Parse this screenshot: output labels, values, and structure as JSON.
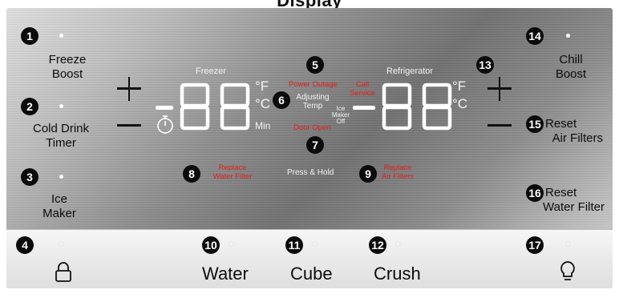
{
  "header": {
    "title_fragment": "Display"
  },
  "left_buttons": [
    {
      "num": "1",
      "label1": "Freeze",
      "label2": "Boost"
    },
    {
      "num": "2",
      "label1": "Cold Drink",
      "label2": "Timer"
    },
    {
      "num": "3",
      "label1": "Ice",
      "label2": "Maker"
    }
  ],
  "right_buttons": [
    {
      "num": "14",
      "label1": "Chill",
      "label2": "Boost"
    },
    {
      "num": "15",
      "label1": "Reset",
      "label2": "Air Filters"
    },
    {
      "num": "16",
      "label1": "Reset",
      "label2": "Water Filter"
    }
  ],
  "adjust": {
    "plus_left": "13"
  },
  "freezer": {
    "title": "Freezer",
    "unit_f": "°F",
    "unit_c": "°C",
    "unit_min": "Min",
    "digits": "88",
    "timer_icon": "stopwatch-icon"
  },
  "refrigerator": {
    "title": "Refrigerator",
    "unit_f": "°F",
    "unit_c": "°C",
    "digits": "88"
  },
  "center": {
    "num5": "5",
    "power_outage": "Power Outage",
    "num6": "6",
    "adjusting_1": "Adjusting",
    "adjusting_2": "Temp",
    "call_service_1": "Call",
    "call_service_2": "Service",
    "ice_maker_off_1": "Ice",
    "ice_maker_off_2": "Maker",
    "ice_maker_off_3": "Off",
    "door_open": "Door Open",
    "num7": "7",
    "num8": "8",
    "replace_water_1": "Replace",
    "replace_water_2": "Water Filter",
    "press_hold": "Press & Hold",
    "num9": "9",
    "replace_air_1": "Replace",
    "replace_air_2": "Air Filters"
  },
  "bottom": {
    "lock": {
      "num": "4",
      "icon": "lock-icon"
    },
    "water": {
      "num": "10",
      "label": "Water"
    },
    "cube": {
      "num": "11",
      "label": "Cube"
    },
    "crush": {
      "num": "12",
      "label": "Crush"
    },
    "light": {
      "num": "17",
      "icon": "light-bulb-icon"
    }
  },
  "colors": {
    "alert_red": "#e0201c",
    "badge": "#0b0b0b",
    "segment": "#ffffff"
  }
}
